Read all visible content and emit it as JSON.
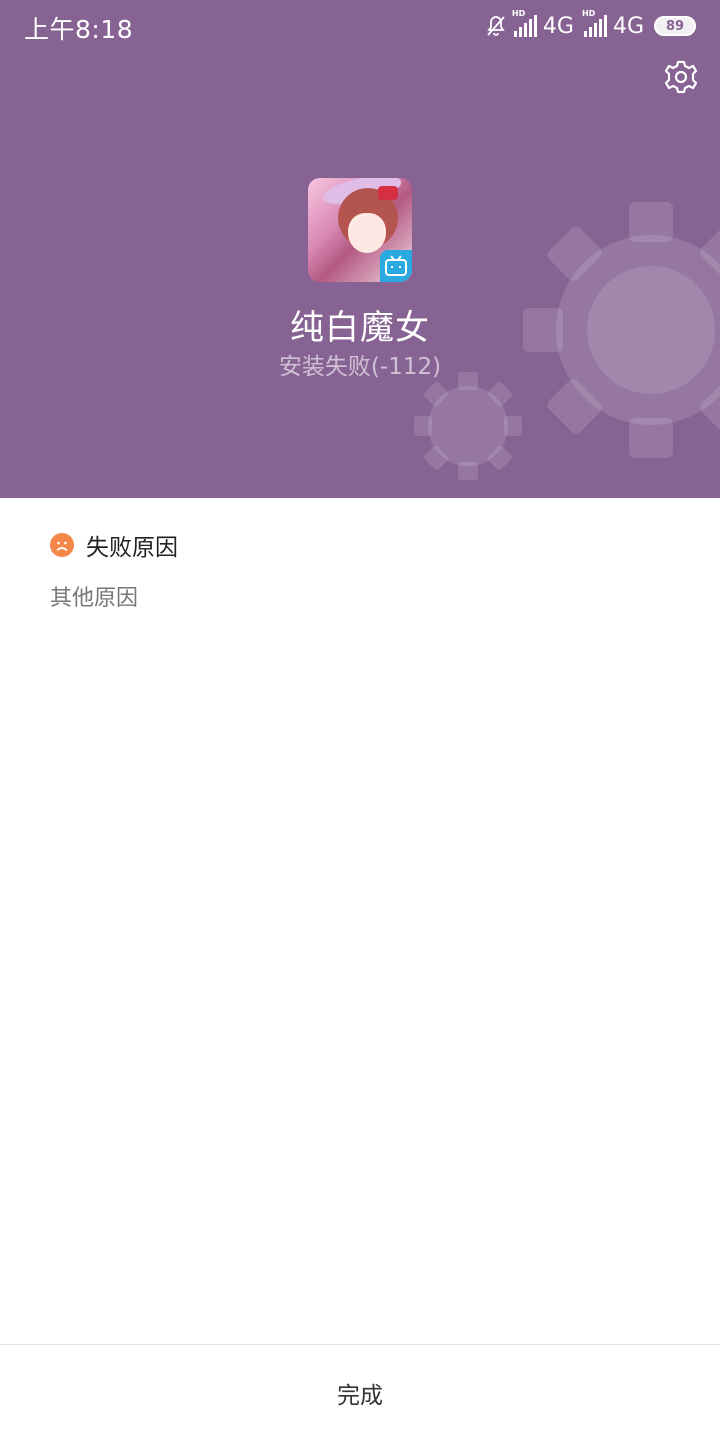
{
  "status_bar": {
    "time": "上午8:18",
    "network_1": "4G",
    "network_2": "4G",
    "battery_level": "89",
    "icons": [
      "mute-bell-icon",
      "signal-hd-icon",
      "signal-hd-icon",
      "battery-icon"
    ]
  },
  "header": {
    "background_color": "#876393",
    "settings_icon": "gear-icon",
    "app_icon": "app-icon",
    "app_name": "纯白魔女",
    "install_status": "安装失败(-112)"
  },
  "reason": {
    "icon": "sad-face-icon",
    "icon_color": "#f5874a",
    "title": "失败原因",
    "detail": "其他原因"
  },
  "footer": {
    "done_label": "完成"
  }
}
